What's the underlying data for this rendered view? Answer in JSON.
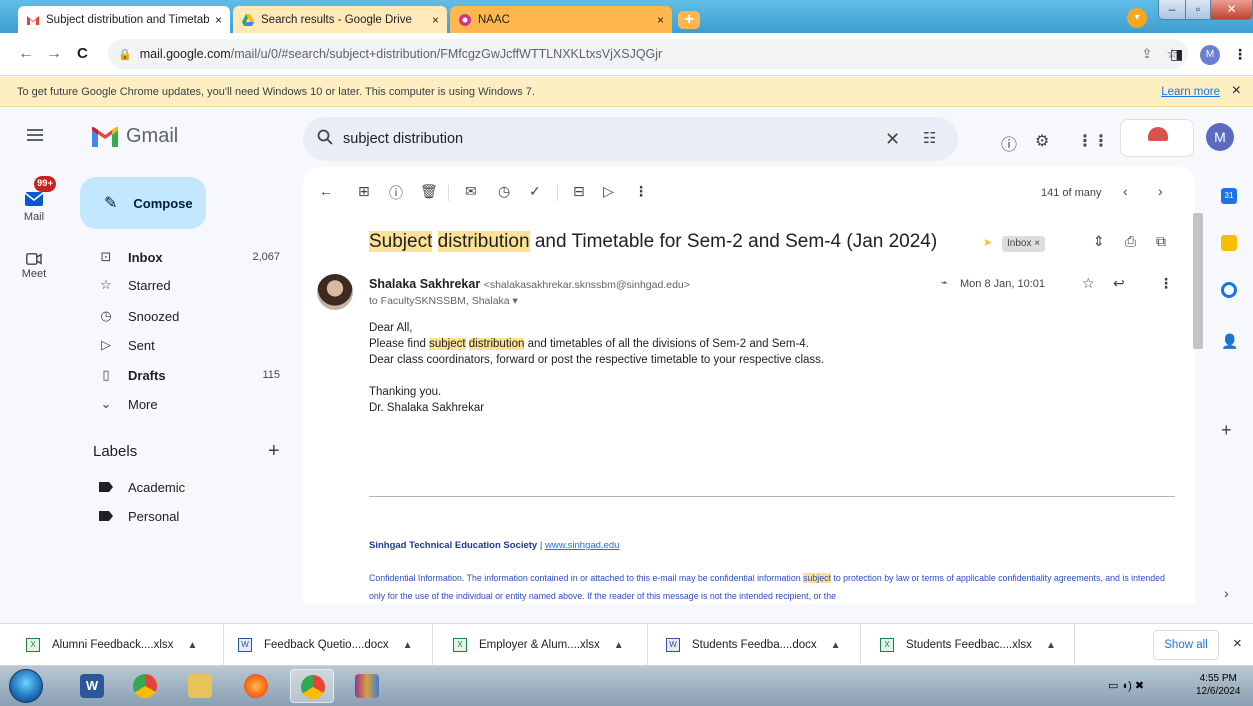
{
  "browser": {
    "tabs": [
      {
        "title": "Subject distribution and Timetab",
        "close": "×"
      },
      {
        "title": "Search results - Google Drive",
        "close": "×"
      },
      {
        "title": "NAAC",
        "close": "×"
      }
    ],
    "new_tab": "+",
    "url_host": "mail.google.com",
    "url_path": "/mail/u/0/#search/subject+distribution/FMfcgzGwJcffWTTLNXKLtxsVjXSJQGjr",
    "profile_initial": "M"
  },
  "banner": {
    "text": "To get future Google Chrome updates, you'll need Windows 10 or later. This computer is using Windows 7.",
    "learn_more": "Learn more",
    "close": "×"
  },
  "gmail": {
    "logo_text": "Gmail",
    "search_value": "subject distribution",
    "account_initial": "M",
    "rail": {
      "mail_label": "Mail",
      "mail_badge": "99+",
      "meet_label": "Meet"
    },
    "compose_label": "Compose",
    "nav": [
      {
        "label": "Inbox",
        "count": "2,067",
        "bold": true
      },
      {
        "label": "Starred",
        "count": ""
      },
      {
        "label": "Snoozed",
        "count": ""
      },
      {
        "label": "Sent",
        "count": ""
      },
      {
        "label": "Drafts",
        "count": "115",
        "bold": true
      },
      {
        "label": "More",
        "count": ""
      }
    ],
    "labels_heading": "Labels",
    "labels": [
      "Academic",
      "Personal"
    ]
  },
  "message": {
    "pager": "141 of many",
    "subject_hl1": "Subject",
    "subject_hl2": "distribution",
    "subject_rest": " and Timetable for Sem-2 and Sem-4 (Jan 2024)",
    "label_chip": "Inbox ×",
    "sender_name": "Shalaka Sakhrekar",
    "sender_email": "<shalakasakhrekar.sknssbm@sinhgad.edu>",
    "to_line": "to FacultySKNSSBM, Shalaka ▾",
    "date": "Mon 8 Jan, 10:01",
    "body": {
      "greeting": "Dear All,",
      "line1_pre": "Please find ",
      "line1_hl1": "subject",
      "line1_sp": " ",
      "line1_hl2": "distribution",
      "line1_post": " and timetables of all  the divisions of Sem-2 and Sem-4.",
      "line2": "Dear class coordinators, forward or post the respective timetable to your respective class.",
      "thanks": "Thanking you.",
      "signoff": "Dr. Shalaka Sakhrekar"
    },
    "signature_org": "Sinhgad Technical Education Society",
    "signature_sep": " | ",
    "signature_link": "www.sinhgad.edu",
    "conf_pre": "Confidential Information. The information contained in or attached to this e-mail may be confidential information ",
    "conf_hl": "subject",
    "conf_post": " to protection by law or terms of applicable confidentiality agreements, and is intended only for the use of the individual or entity named above. If the reader of this message is not the intended recipient, or the"
  },
  "downloads": {
    "items": [
      {
        "name": "Alumni Feedback....xlsx",
        "type": "xlsx"
      },
      {
        "name": "Feedback Quetio....docx",
        "type": "docx"
      },
      {
        "name": "Employer & Alum....xlsx",
        "type": "xlsx"
      },
      {
        "name": "Students Feedba....docx",
        "type": "docx"
      },
      {
        "name": "Students Feedbac....xlsx",
        "type": "xlsx"
      }
    ],
    "show_all": "Show all",
    "close": "×"
  },
  "taskbar": {
    "time": "4:55 PM",
    "date": "12/6/2024"
  },
  "colors": {
    "compose_bg": "#c2e7ff",
    "highlight": "#fde293",
    "link": "#1a73e8",
    "banner_bg": "#feefc3"
  }
}
